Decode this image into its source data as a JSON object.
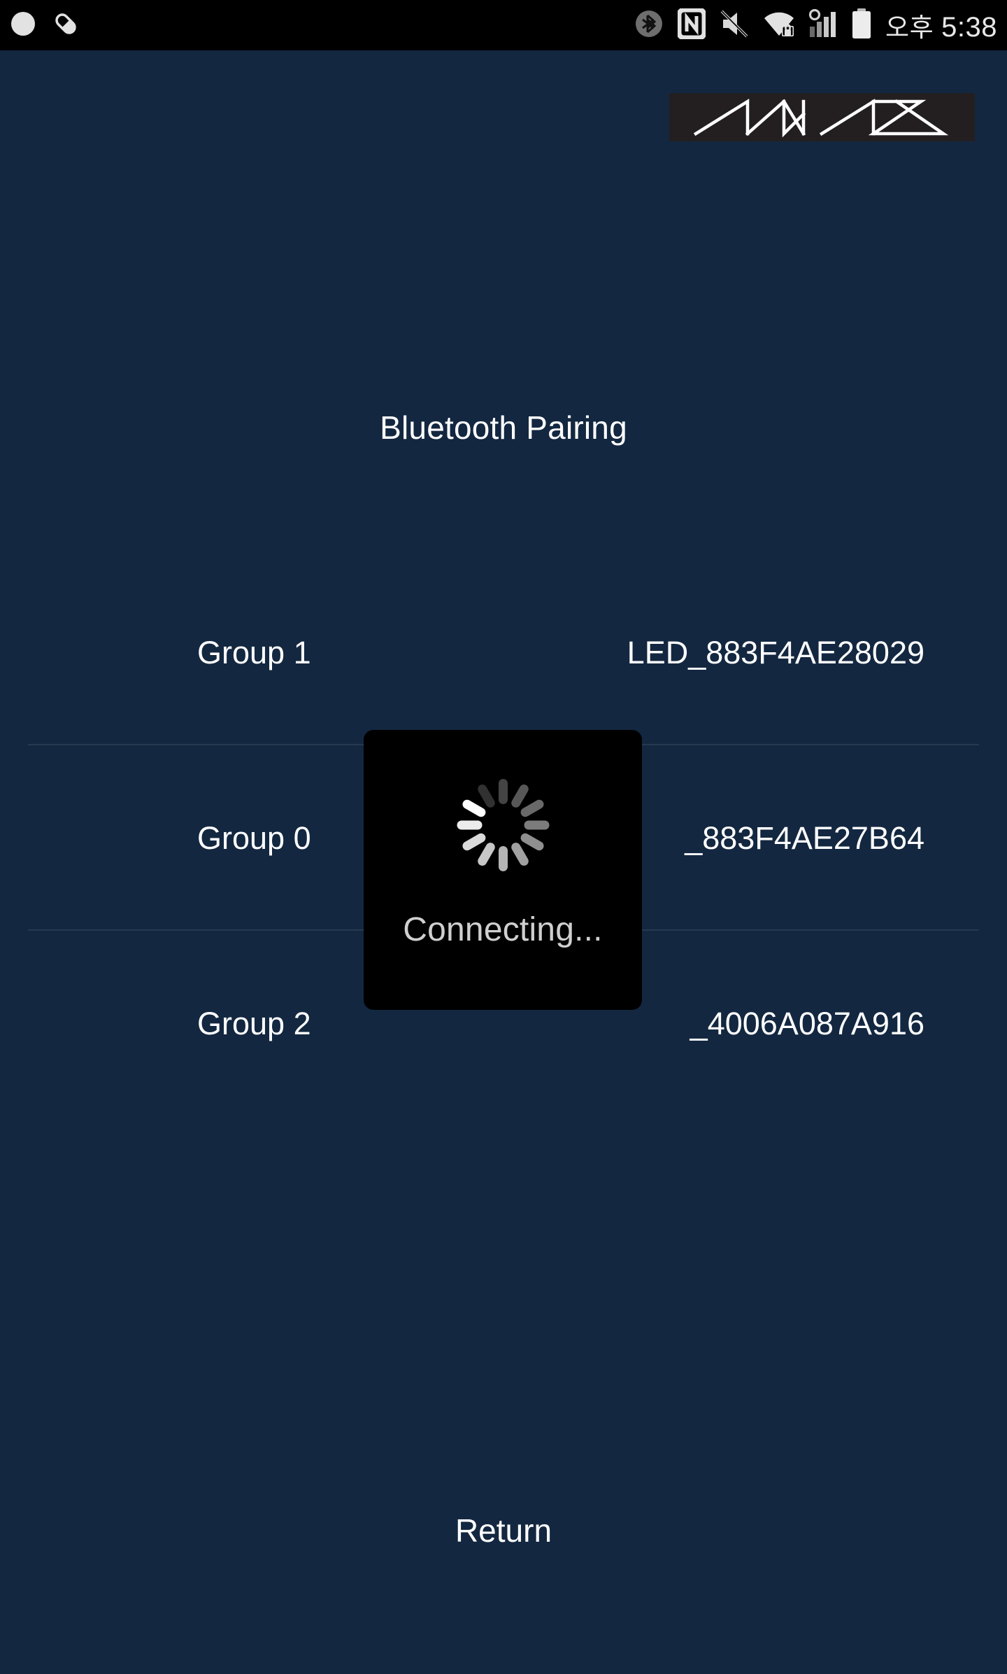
{
  "status_bar": {
    "time": "5:38",
    "am_pm": "오후",
    "left_icons": [
      {
        "name": "circle-notification-icon",
        "glyph": "circle"
      },
      {
        "name": "capsule-notification-icon",
        "glyph": "capsule"
      }
    ],
    "right_icons": [
      {
        "name": "bluetooth-icon",
        "glyph": "bluetooth"
      },
      {
        "name": "nfc-icon",
        "glyph": "nfc"
      },
      {
        "name": "volume-mute-icon",
        "glyph": "mute"
      },
      {
        "name": "wifi-secured-icon",
        "glyph": "wifi-lock"
      },
      {
        "name": "cellular-signal-icon",
        "glyph": "signal"
      },
      {
        "name": "battery-icon",
        "glyph": "battery"
      }
    ],
    "background": "#000000",
    "foreground": "#e8e8e8"
  },
  "brand": {
    "logo_text": "MAVAS",
    "logo_background": "#231f20",
    "logo_stroke": "#ffffff"
  },
  "page": {
    "title": "Bluetooth Pairing",
    "background": "#132740",
    "text_color": "#ffffff"
  },
  "devices": [
    {
      "group": "Group 1",
      "name": "LED_883F4AE28029"
    },
    {
      "group": "Group 0",
      "name": "_883F4AE27B64"
    },
    {
      "group": "Group 2",
      "name": "_4006A087A916"
    }
  ],
  "footer": {
    "return_label": "Return"
  },
  "dialog": {
    "message": "Connecting...",
    "background": "#000000",
    "text_color": "#cfcfcf",
    "spinner_spokes": 12,
    "visible": true
  }
}
